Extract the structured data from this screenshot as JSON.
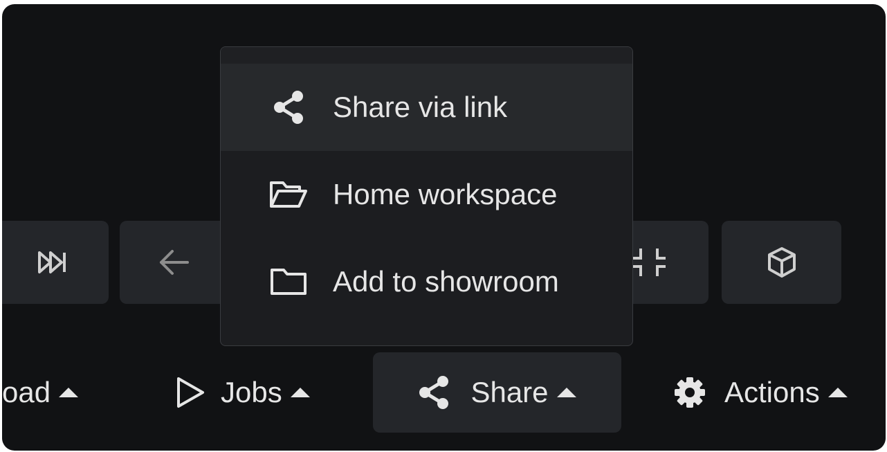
{
  "share_menu": {
    "items": [
      {
        "label": "Share via link",
        "icon": "share-icon"
      },
      {
        "label": "Home workspace",
        "icon": "folder-open-icon"
      },
      {
        "label": "Add to showroom",
        "icon": "folder-icon"
      }
    ]
  },
  "toolbar": {
    "buttons": [
      {
        "icon": "skip-forward-icon"
      },
      {
        "icon": "arrow-left-icon"
      },
      {
        "icon": "collapse-icon"
      },
      {
        "icon": "cube-icon"
      }
    ]
  },
  "bottom_bar": {
    "items": [
      {
        "label": "oad",
        "icon": ""
      },
      {
        "label": "Jobs",
        "icon": "play-icon"
      },
      {
        "label": "Share",
        "icon": "share-icon",
        "active": true
      },
      {
        "label": "Actions",
        "icon": "gear-icon"
      }
    ]
  },
  "colors": {
    "background": "#111214",
    "panel": "#24262a",
    "menu": "#1c1d20",
    "menu_highlight": "#27292c",
    "text": "#e6e6e6"
  }
}
